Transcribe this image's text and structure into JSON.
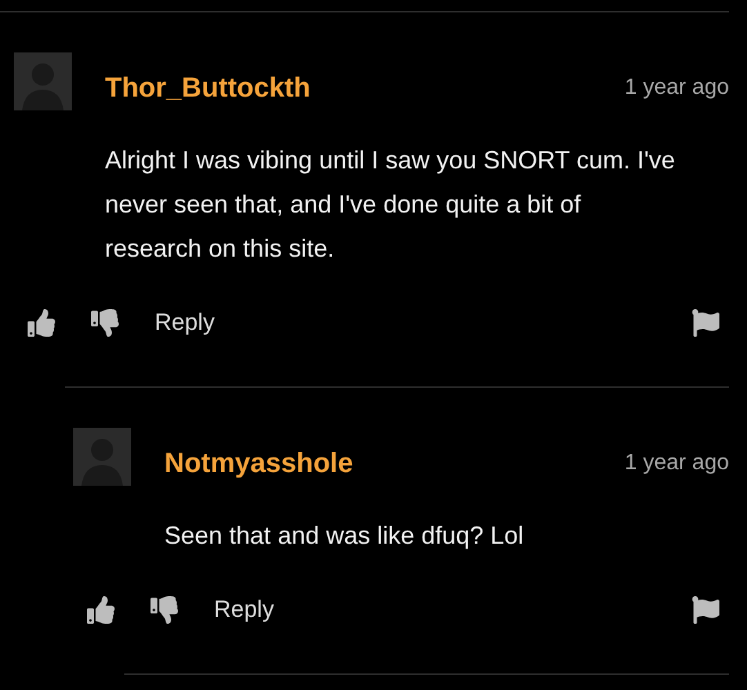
{
  "comments": [
    {
      "author": "Thor_Buttockth",
      "time": "1 year ago",
      "text": "Alright I was vibing until I saw you SNORT cum. I've never seen that, and I've done quite a bit of research on this site.",
      "reply_label": "Reply",
      "children": [
        {
          "author": "Notmyasshole",
          "time": "1 year ago",
          "text": "Seen that and was like dfuq? Lol",
          "reply_label": "Reply"
        }
      ]
    }
  ]
}
